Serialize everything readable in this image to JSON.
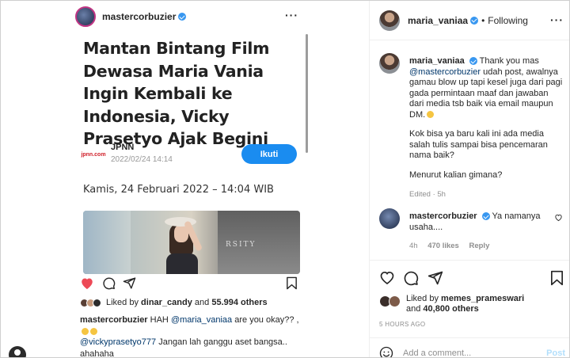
{
  "left_post": {
    "username": "mastercorbuzier",
    "article": {
      "headline": "Mantan Bintang Film Dewasa Maria Vania Ingin Kembali ke Indonesia, Vicky Prasetyo Ajak Begini",
      "source_logo": "jpnn.com",
      "source_name": "JPNN",
      "source_date": "2022/02/24 14:14",
      "follow_label": "Ikuti",
      "date_line": "Kamis, 24 Februari 2022 – 14:04 WIB",
      "photo_sign": "RSITY"
    },
    "likes": {
      "prefix": "Liked by",
      "user": "dinar_candy",
      "and": "and",
      "count": "55.994 others"
    },
    "caption": {
      "user": "mastercorbuzier",
      "text_before": "HAH",
      "mention": "@maria_vaniaa",
      "text_after": "are you okay?? ,"
    },
    "comment": {
      "mention": "@vickyprasetyo777",
      "text": "Jangan lah ganggu aset bangsa.. ahahaha"
    }
  },
  "right_panel": {
    "header": {
      "username": "maria_vaniaa",
      "separator": "•",
      "following_label": "Following"
    },
    "comments": [
      {
        "username": "maria_vaniaa",
        "p1_before": "Thank you mas",
        "p1_mention": "@mastercorbuzier",
        "p1_after": "udah post, awalnya gamau blow up tapi kesel juga dari pagi gada permintaan maaf dan jawaban dari media tsb baik via email maupun DM.",
        "p2": "Kok bisa ya baru kali ini ada media salah tulis sampai bisa pencemaran nama baik?",
        "p3": "Menurut kalian gimana?",
        "meta": "Edited · 5h"
      },
      {
        "username": "mastercorbuzier",
        "text": "Ya namanya usaha....",
        "meta_time": "4h",
        "meta_likes": "470 likes",
        "meta_reply": "Reply"
      }
    ],
    "likes": {
      "prefix": "Liked by",
      "user": "memes_prameswari",
      "and": "and",
      "count": "40,800 others"
    },
    "timestamp": "5 HOURS AGO",
    "add_comment_placeholder": "Add a comment...",
    "post_label": "Post"
  }
}
